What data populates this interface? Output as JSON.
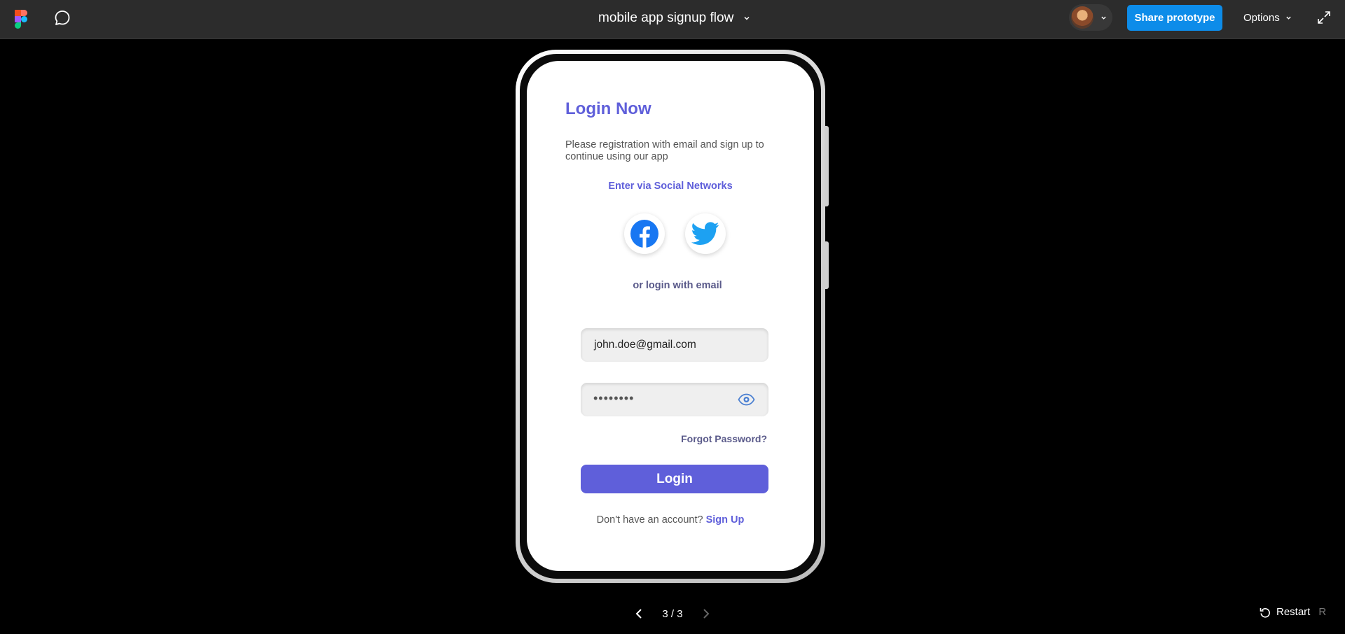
{
  "header": {
    "file_title": "mobile app signup flow",
    "share_label": "Share prototype",
    "options_label": "Options"
  },
  "screen": {
    "title": "Login Now",
    "description": "Please registration with email and sign up to continue using our app",
    "social_label": "Enter via Social Networks",
    "or_label": "or login with email",
    "email_value": "john.doe@gmail.com",
    "password_masked": "••••••••",
    "forgot_label": "Forgot Password?",
    "login_label": "Login",
    "no_account_label": "Don't have an account?",
    "signup_label": "Sign Up",
    "accent_color": "#5f5fda"
  },
  "footer": {
    "page_indicator": "3 / 3",
    "restart_label": "Restart",
    "restart_shortcut": "R"
  },
  "icons": {
    "logo": "figma-logo-icon",
    "comment": "comment-icon",
    "expand": "expand-icon",
    "facebook": "facebook-icon",
    "twitter": "twitter-icon",
    "eye": "eye-icon"
  }
}
